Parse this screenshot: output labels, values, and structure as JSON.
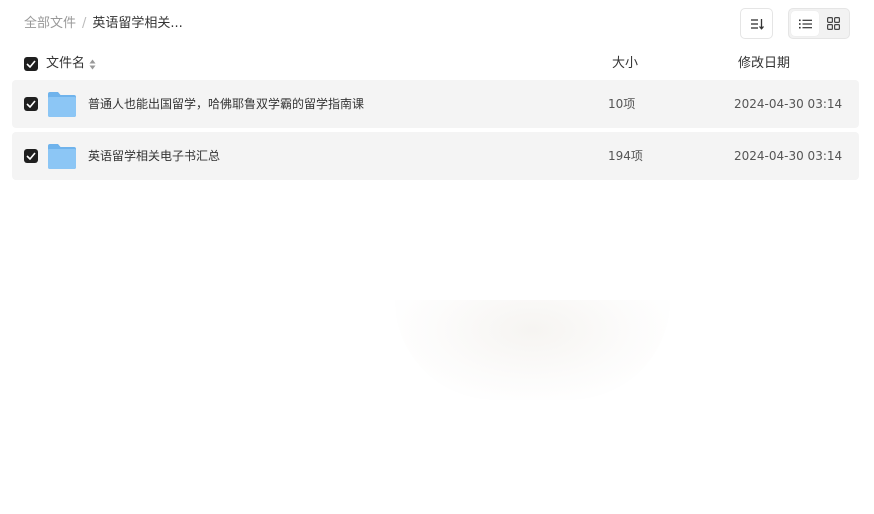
{
  "breadcrumb": {
    "root": "全部文件",
    "separator": "/",
    "current": "英语留学相关..."
  },
  "toolbar": {
    "sort_icon": "sort-icon",
    "list_view_icon": "list-view-icon",
    "grid_view_icon": "grid-view-icon",
    "active_view": "list"
  },
  "table": {
    "headers": {
      "name": "文件名",
      "size": "大小",
      "date": "修改日期"
    },
    "rows": [
      {
        "name": "普通人也能出国留学，哈佛耶鲁双学霸的留学指南课",
        "size": "10项",
        "date": "2024-04-30 03:14",
        "checked": true,
        "icon": "folder-icon"
      },
      {
        "name": "英语留学相关电子书汇总",
        "size": "194项",
        "date": "2024-04-30 03:14",
        "checked": true,
        "icon": "folder-icon"
      }
    ]
  },
  "colors": {
    "checkbox": "#1f1f1f",
    "row_background": "#f4f4f4",
    "folder": "#7fbdf0"
  }
}
